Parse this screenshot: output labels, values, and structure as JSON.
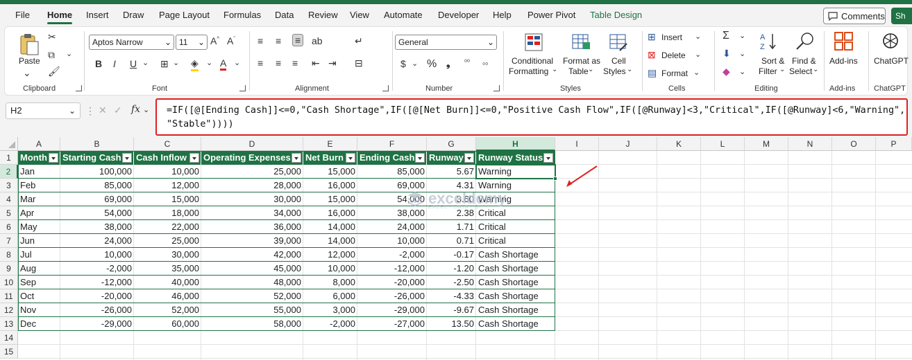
{
  "menu": {
    "tabs": [
      "File",
      "Home",
      "Insert",
      "Draw",
      "Page Layout",
      "Formulas",
      "Data",
      "Review",
      "View",
      "Automate",
      "Developer",
      "Help",
      "Power Pivot",
      "Table Design"
    ],
    "comments_label": "Comments",
    "share_label": "Sh"
  },
  "ribbon": {
    "clipboard": {
      "paste": "Paste",
      "label": "Clipboard"
    },
    "font": {
      "name": "Aptos Narrow",
      "size": "11",
      "label": "Font"
    },
    "alignment": {
      "label": "Alignment"
    },
    "number": {
      "format": "General",
      "label": "Number"
    },
    "styles": {
      "conditional": "Conditional",
      "conditional2": "Formatting",
      "format_as": "Format as",
      "format_as2": "Table",
      "cell": "Cell",
      "cell2": "Styles",
      "label": "Styles"
    },
    "cells": {
      "insert": "Insert",
      "delete": "Delete",
      "format": "Format",
      "label": "Cells"
    },
    "editing": {
      "sort": "Sort &",
      "sort2": "Filter",
      "find": "Find &",
      "find2": "Select",
      "label": "Editing"
    },
    "addins": {
      "btn": "Add-ins",
      "label": "Add-ins"
    },
    "chatgpt": {
      "btn": "ChatGPT",
      "label": "ChatGPT"
    }
  },
  "formula_bar": {
    "name_box": "H2",
    "fx": "fx",
    "formula_line1": "=IF([@[Ending Cash]]<=0,\"Cash Shortage\",IF([@[Net Burn]]<=0,\"Positive Cash Flow\",IF([@Runway]<3,\"Critical\",IF([@Runway]<6,\"Warning\",",
    "formula_line2": "\"Stable\"))))"
  },
  "sheet": {
    "columns": [
      "A",
      "B",
      "C",
      "D",
      "E",
      "F",
      "G",
      "H",
      "I",
      "J",
      "K",
      "L",
      "M",
      "N",
      "O",
      "P"
    ],
    "rows": [
      "1",
      "2",
      "3",
      "4",
      "5",
      "6",
      "7",
      "8",
      "9",
      "10",
      "11",
      "12",
      "13",
      "14",
      "15"
    ],
    "headers": [
      "Month",
      "Starting Cash",
      "Cash Inflow",
      "Operating Expenses",
      "Net Burn",
      "Ending Cash",
      "Runway",
      "Runway Status"
    ],
    "data": [
      [
        "Jan",
        "100,000",
        "10,000",
        "25,000",
        "15,000",
        "85,000",
        "5.67",
        "Warning"
      ],
      [
        "Feb",
        "85,000",
        "12,000",
        "28,000",
        "16,000",
        "69,000",
        "4.31",
        "Warning"
      ],
      [
        "Mar",
        "69,000",
        "15,000",
        "30,000",
        "15,000",
        "54,000",
        "3.60",
        "Warning"
      ],
      [
        "Apr",
        "54,000",
        "18,000",
        "34,000",
        "16,000",
        "38,000",
        "2.38",
        "Critical"
      ],
      [
        "May",
        "38,000",
        "22,000",
        "36,000",
        "14,000",
        "24,000",
        "1.71",
        "Critical"
      ],
      [
        "Jun",
        "24,000",
        "25,000",
        "39,000",
        "14,000",
        "10,000",
        "0.71",
        "Critical"
      ],
      [
        "Jul",
        "10,000",
        "30,000",
        "42,000",
        "12,000",
        "-2,000",
        "-0.17",
        "Cash Shortage"
      ],
      [
        "Aug",
        "-2,000",
        "35,000",
        "45,000",
        "10,000",
        "-12,000",
        "-1.20",
        "Cash Shortage"
      ],
      [
        "Sep",
        "-12,000",
        "40,000",
        "48,000",
        "8,000",
        "-20,000",
        "-2.50",
        "Cash Shortage"
      ],
      [
        "Oct",
        "-20,000",
        "46,000",
        "52,000",
        "6,000",
        "-26,000",
        "-4.33",
        "Cash Shortage"
      ],
      [
        "Nov",
        "-26,000",
        "52,000",
        "55,000",
        "3,000",
        "-29,000",
        "-9.67",
        "Cash Shortage"
      ],
      [
        "Dec",
        "-29,000",
        "60,000",
        "58,000",
        "-2,000",
        "-27,000",
        "13.50",
        "Cash Shortage"
      ]
    ]
  },
  "watermark": {
    "name": "exceldemy",
    "tag": "EXCEL · DATA · BI"
  },
  "colors": {
    "accent": "#1f7244",
    "highlight": "#e02020"
  }
}
